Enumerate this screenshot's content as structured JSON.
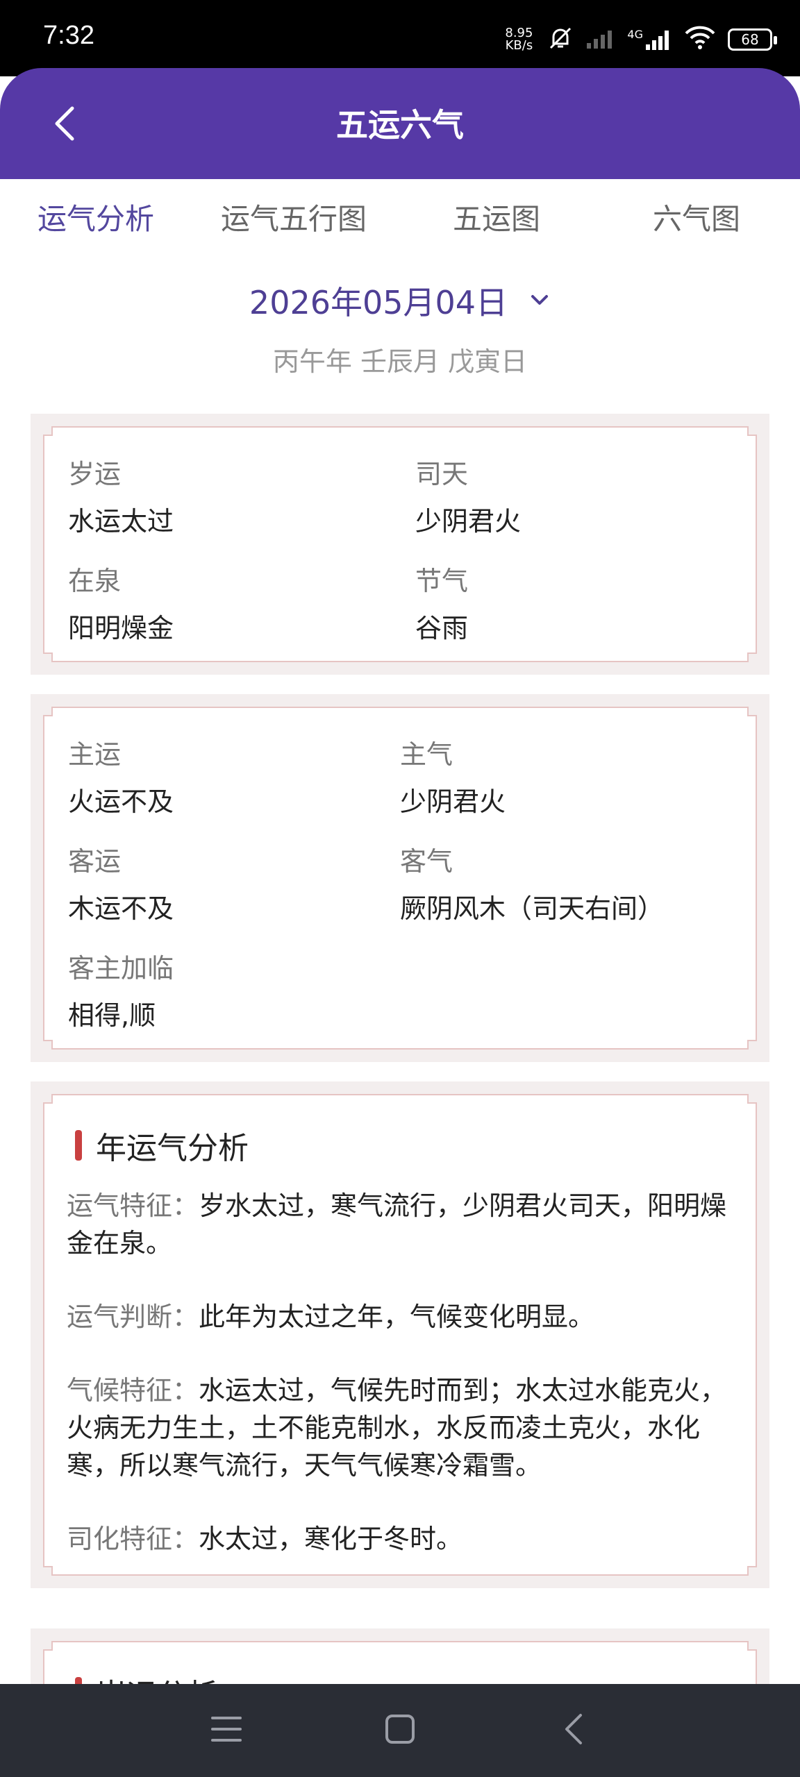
{
  "status_bar": {
    "time": "7:32",
    "net_speed_value": "8.95",
    "net_speed_unit": "KB/s",
    "network_type": "4G",
    "battery": "68"
  },
  "header": {
    "title": "五运六气"
  },
  "tabs": [
    {
      "label": "运气分析",
      "active": true
    },
    {
      "label": "运气五行图",
      "active": false
    },
    {
      "label": "五运图",
      "active": false
    },
    {
      "label": "六气图",
      "active": false
    }
  ],
  "date": {
    "value": "2026年05月04日",
    "ganzhi": "丙午年 壬辰月 戊寅日"
  },
  "card1": {
    "suiyun_label": "岁运",
    "suiyun_value": "水运太过",
    "sitian_label": "司天",
    "sitian_value": "少阴君火",
    "zaiquan_label": "在泉",
    "zaiquan_value": "阳明燥金",
    "jieqi_label": "节气",
    "jieqi_value": "谷雨"
  },
  "card2": {
    "zhuyun_label": "主运",
    "zhuyun_value": "火运不及",
    "zhuqi_label": "主气",
    "zhuqi_value": "少阴君火",
    "keyun_label": "客运",
    "keyun_value": "木运不及",
    "keqi_label": "客气",
    "keqi_value": "厥阴风木（司天右间）",
    "jialin_label": "客主加临",
    "jialin_value": "相得,顺"
  },
  "analysis": {
    "title": "年运气分析",
    "items": [
      {
        "key": "运气特征：",
        "text": "岁水太过，寒气流行，少阴君火司天，阳明燥金在泉。"
      },
      {
        "key": "运气判断：",
        "text": "此年为太过之年，气候变化明显。"
      },
      {
        "key": "气候特征：",
        "text": "水运太过，气候先时而到；水太过水能克火，火病无力生土，土不能克制水，水反而凌土克火，水化寒，所以寒气流行，天气气候寒冷霜雪。"
      },
      {
        "key": "司化特征：",
        "text": "水太过，寒化于冬时。"
      }
    ]
  },
  "next_section": {
    "title": "岁运分析"
  },
  "colors": {
    "header_bg": "#5639a6",
    "accent_text": "#53479e",
    "marker": "#c94040",
    "card_border": "#e6c4c3",
    "nav_bg": "#2a2d35"
  }
}
